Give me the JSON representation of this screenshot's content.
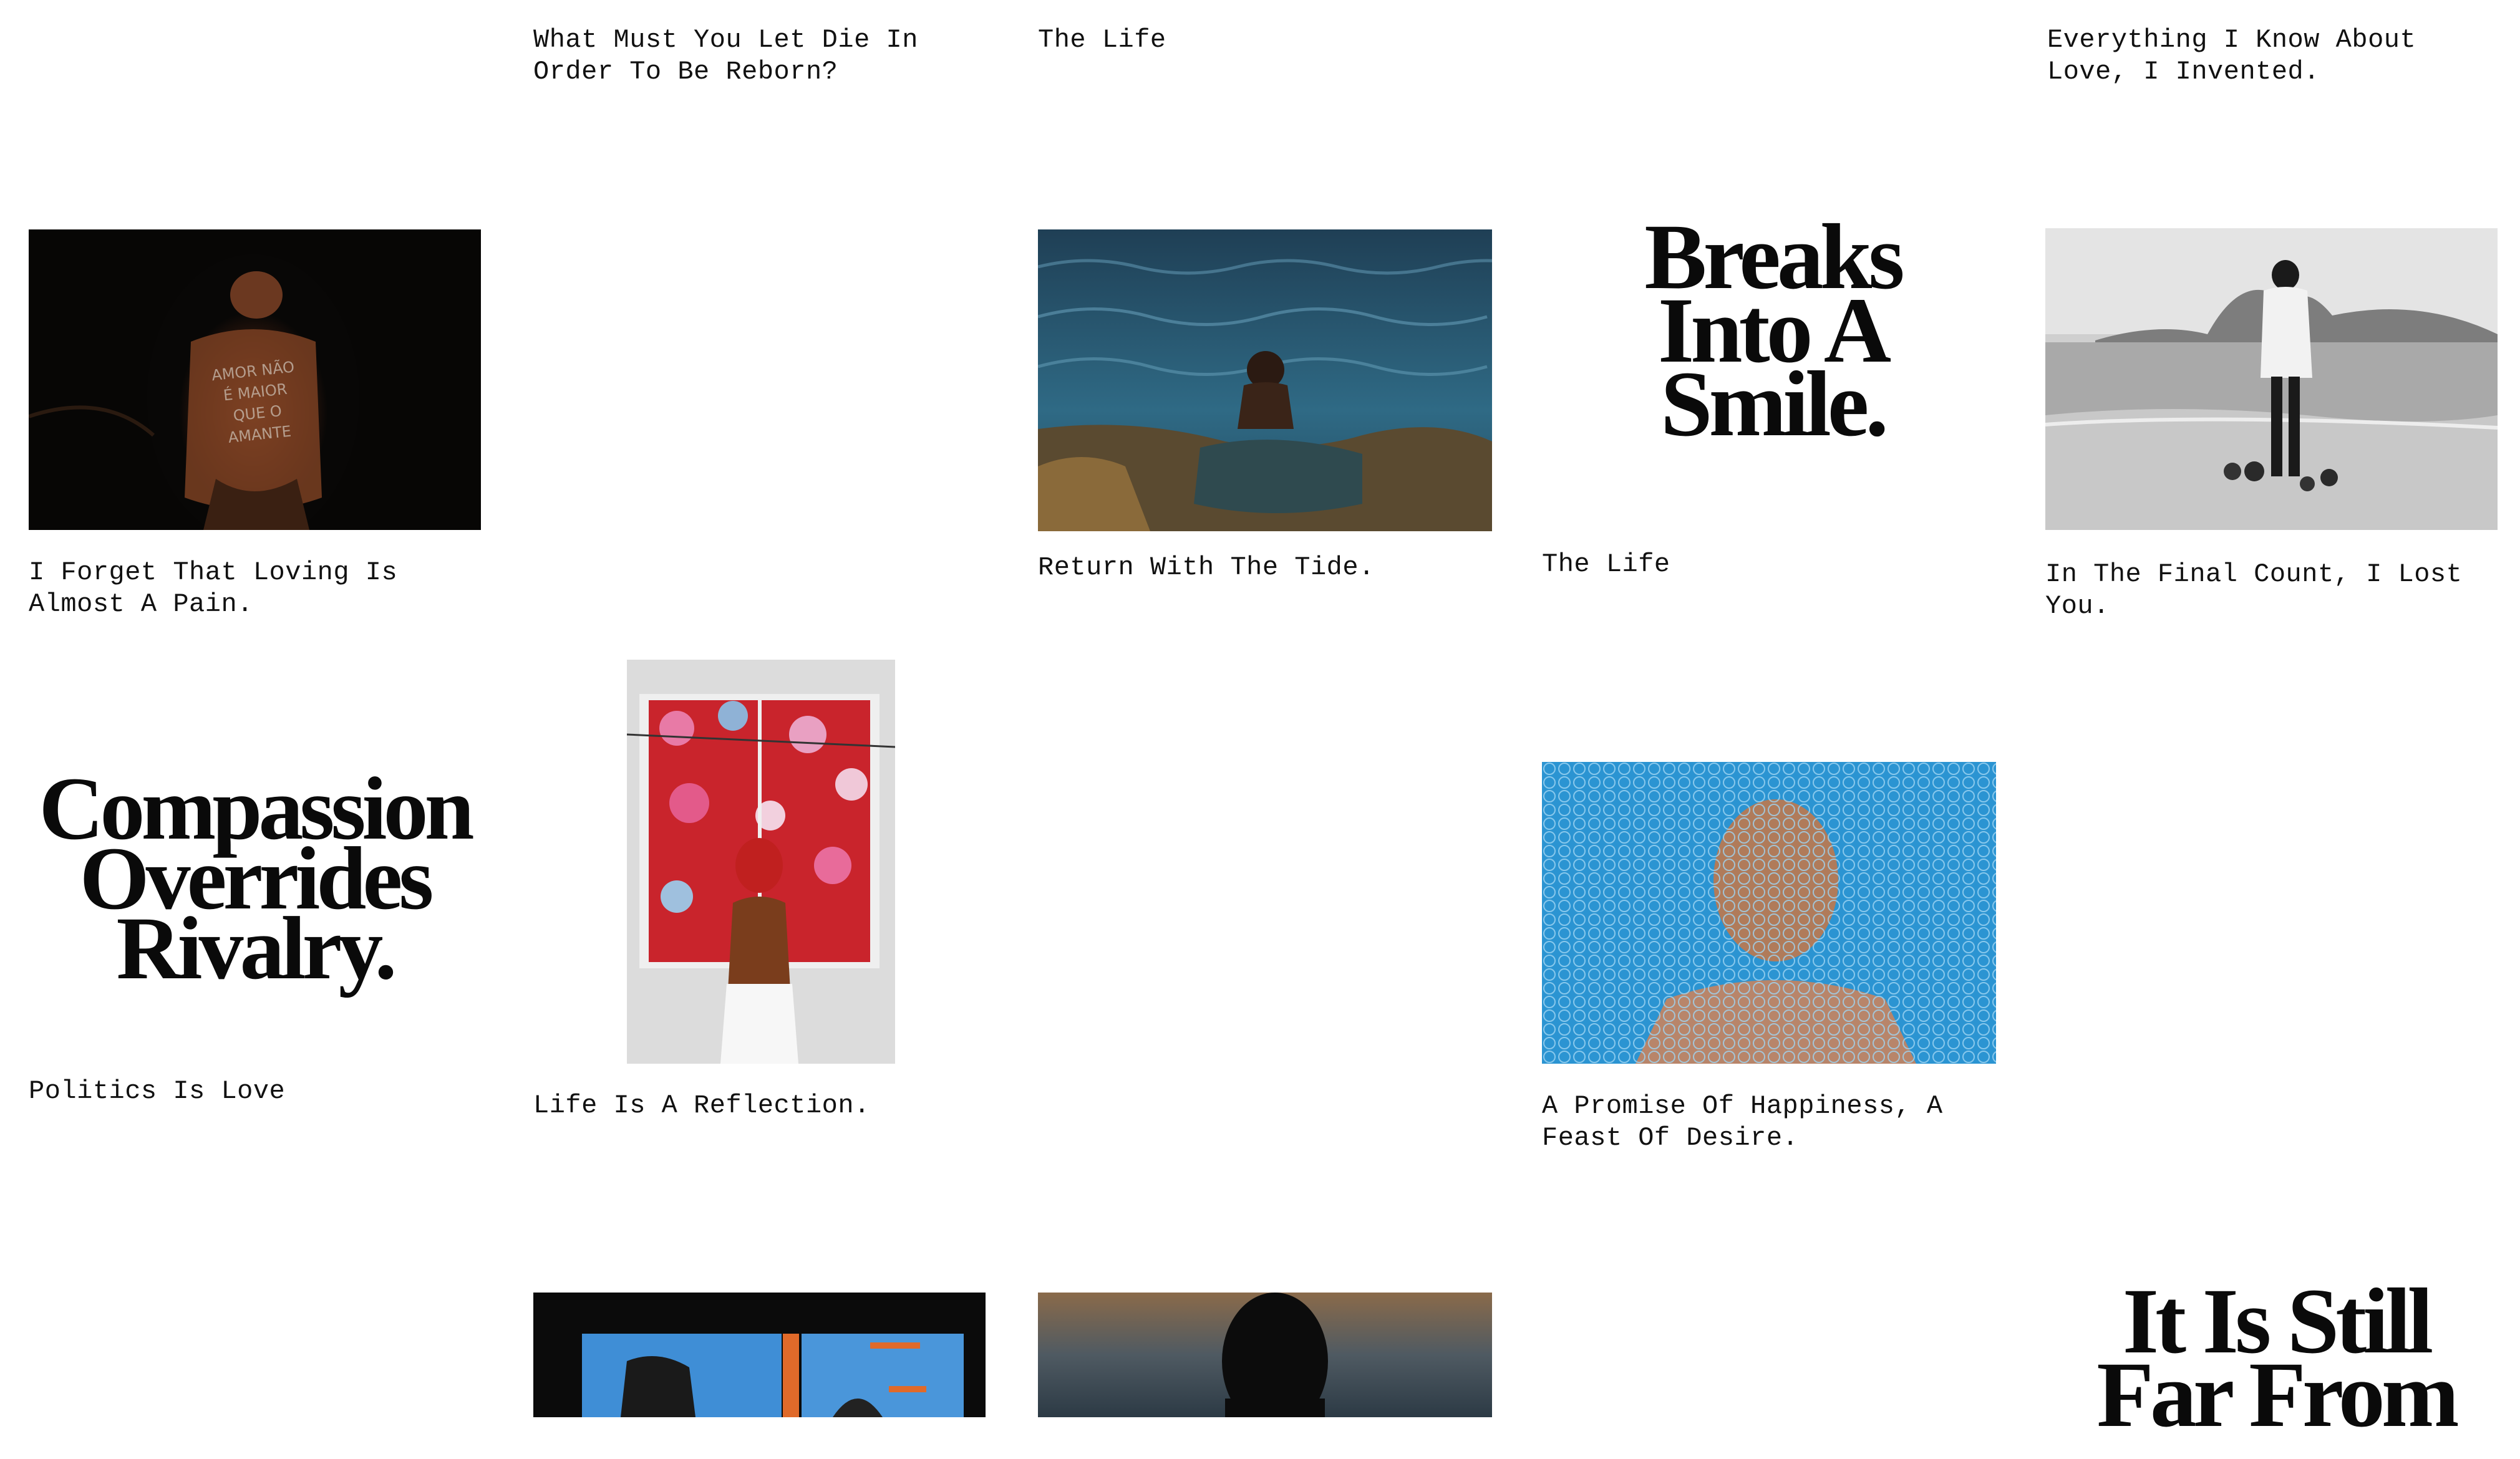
{
  "grid": {
    "top_captions": {
      "item1": "What Must You Let Die In Order To Be Reborn?",
      "item2": "The Life",
      "item3": "Everything I Know About Love, I Invented."
    },
    "row1": {
      "forget": {
        "caption": "I Forget That Loving Is Almost A Pain.",
        "body_text": "AMOR NÃO É MAIOR QUE O AMANTE"
      },
      "tide": {
        "caption": "Return With The Tide."
      },
      "breaks": {
        "caption": "The Life",
        "lines": [
          "Breaks",
          "Into A",
          "Smile."
        ]
      },
      "final": {
        "caption": "In The Final Count, I Lost You."
      }
    },
    "row2": {
      "compassion": {
        "caption": "Politics Is Love",
        "lines": [
          "Compassion",
          "Overrides",
          "Rivalry."
        ]
      },
      "reflection": {
        "caption": "Life Is A Reflection."
      },
      "promise": {
        "caption": "A Promise Of Happiness, A Feast Of Desire."
      }
    },
    "row3": {
      "still": {
        "lines": [
          "It Is Still",
          "Far From"
        ]
      }
    }
  },
  "colors": {
    "background": "#ffffff",
    "text": "#111111",
    "sea": "#2f5d74",
    "bubble_blue": "#2f9bd8",
    "flower_red": "#d42a2a"
  }
}
